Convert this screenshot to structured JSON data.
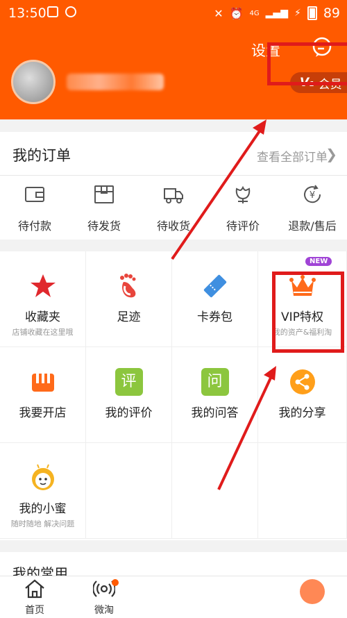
{
  "status_bar": {
    "time": "13:50",
    "network": "4G",
    "battery": "89"
  },
  "header": {
    "settings_label": "设置",
    "vip_label": "会员"
  },
  "orders": {
    "title": "我的订单",
    "view_all": "查看全部订单",
    "items": [
      {
        "label": "待付款",
        "icon": "wallet-icon"
      },
      {
        "label": "待发货",
        "icon": "package-icon"
      },
      {
        "label": "待收货",
        "icon": "truck-icon"
      },
      {
        "label": "待评价",
        "icon": "flower-icon"
      },
      {
        "label": "退款/售后",
        "icon": "refund-icon"
      }
    ]
  },
  "grid": {
    "items": [
      {
        "label": "收藏夹",
        "sub": "店铺收藏在这里哦",
        "icon": "star-icon",
        "color": "#e0282d"
      },
      {
        "label": "足迹",
        "sub": "",
        "icon": "footprint-icon",
        "color": "#e8453c"
      },
      {
        "label": "卡券包",
        "sub": "",
        "icon": "ticket-icon",
        "color": "#3f8fe0"
      },
      {
        "label": "VIP特权",
        "sub": "我的资产&福利淘",
        "icon": "crown-icon",
        "color": "#ff6a1a",
        "badge": "NEW"
      },
      {
        "label": "我要开店",
        "sub": "",
        "icon": "shop-icon",
        "color": "#ff6a1a"
      },
      {
        "label": "我的评价",
        "sub": "",
        "icon": "review-icon",
        "color": "#8cc63e",
        "glyph": "评"
      },
      {
        "label": "我的问答",
        "sub": "",
        "icon": "qa-icon",
        "color": "#8cc63e",
        "glyph": "问"
      },
      {
        "label": "我的分享",
        "sub": "",
        "icon": "share-icon",
        "color": "#ff9f1a"
      },
      {
        "label": "我的小蜜",
        "sub": "随时随地 解决问题",
        "icon": "bee-icon",
        "color": "#f5b321"
      }
    ]
  },
  "common": {
    "title": "我的常用"
  },
  "tabbar": {
    "home": "首页",
    "weitao": "微淘"
  },
  "colors": {
    "brand": "#ff5a00",
    "annotation": "#e01b1b"
  }
}
